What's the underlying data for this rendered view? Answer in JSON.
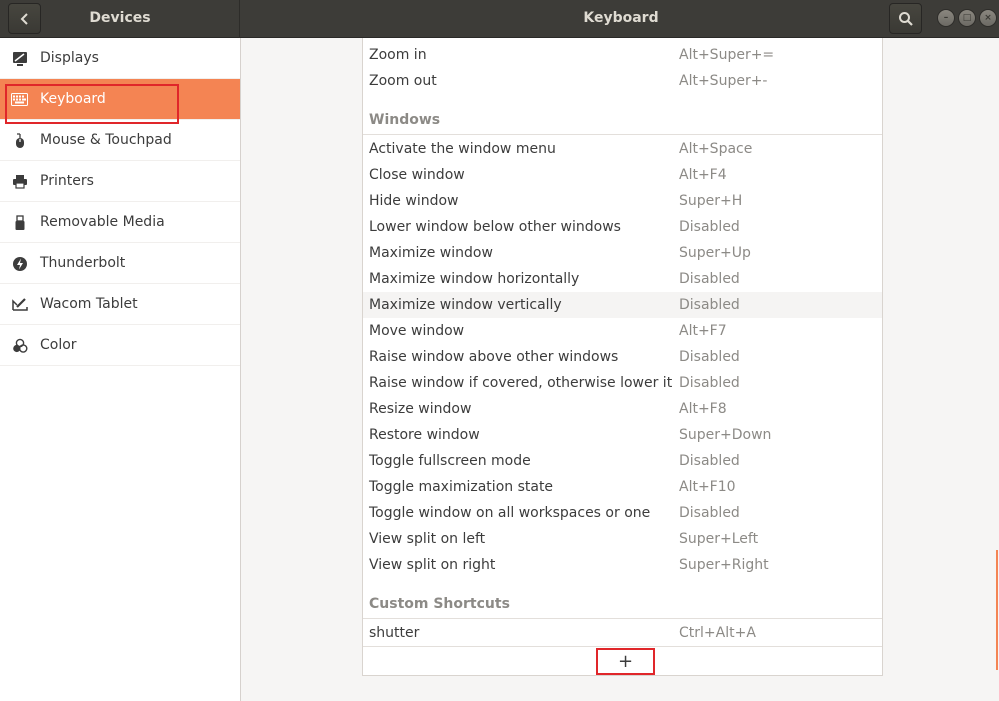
{
  "header": {
    "back_label": "",
    "panel_title": "Devices",
    "page_title": "Keyboard",
    "window_controls": [
      "–",
      "□",
      "×"
    ]
  },
  "sidebar": {
    "items": [
      {
        "label": "Displays",
        "icon": "display-icon"
      },
      {
        "label": "Keyboard",
        "icon": "keyboard-icon"
      },
      {
        "label": "Mouse & Touchpad",
        "icon": "mouse-icon"
      },
      {
        "label": "Printers",
        "icon": "printer-icon"
      },
      {
        "label": "Removable Media",
        "icon": "usb-icon"
      },
      {
        "label": "Thunderbolt",
        "icon": "thunderbolt-icon"
      },
      {
        "label": "Wacom Tablet",
        "icon": "tablet-icon"
      },
      {
        "label": "Color",
        "icon": "color-icon"
      }
    ],
    "active_color": "#f48453"
  },
  "shortcuts": {
    "zoom": [
      {
        "name": "Zoom in",
        "accel": "Alt+Super+="
      },
      {
        "name": "Zoom out",
        "accel": "Alt+Super+-"
      }
    ],
    "windows_heading": "Windows",
    "windows": [
      {
        "name": "Activate the window menu",
        "accel": "Alt+Space"
      },
      {
        "name": "Close window",
        "accel": "Alt+F4"
      },
      {
        "name": "Hide window",
        "accel": "Super+H"
      },
      {
        "name": "Lower window below other windows",
        "accel": "Disabled"
      },
      {
        "name": "Maximize window",
        "accel": "Super+Up"
      },
      {
        "name": "Maximize window horizontally",
        "accel": "Disabled"
      },
      {
        "name": "Maximize window vertically",
        "accel": "Disabled"
      },
      {
        "name": "Move window",
        "accel": "Alt+F7"
      },
      {
        "name": "Raise window above other windows",
        "accel": "Disabled"
      },
      {
        "name": "Raise window if covered, otherwise lower it",
        "accel": "Disabled"
      },
      {
        "name": "Resize window",
        "accel": "Alt+F8"
      },
      {
        "name": "Restore window",
        "accel": "Super+Down"
      },
      {
        "name": "Toggle fullscreen mode",
        "accel": "Disabled"
      },
      {
        "name": "Toggle maximization state",
        "accel": "Alt+F10"
      },
      {
        "name": "Toggle window on all workspaces or one",
        "accel": "Disabled"
      },
      {
        "name": "View split on left",
        "accel": "Super+Left"
      },
      {
        "name": "View split on right",
        "accel": "Super+Right"
      }
    ],
    "custom_heading": "Custom Shortcuts",
    "custom": [
      {
        "name": "shutter",
        "accel": "Ctrl+Alt+A"
      }
    ],
    "add_label": "+"
  }
}
